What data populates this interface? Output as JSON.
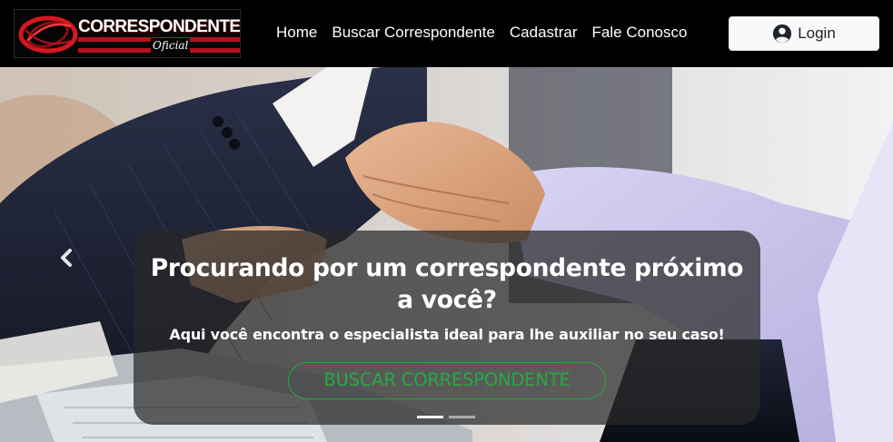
{
  "brand": {
    "logo_title": "CORRESPONDENTE",
    "logo_subtitle": "Oficial",
    "logo_icon": "red-ring-emblem"
  },
  "nav": {
    "items": [
      {
        "label": "Home"
      },
      {
        "label": "Buscar Correspondente"
      },
      {
        "label": "Cadastrar"
      },
      {
        "label": "Fale Conosco"
      }
    ],
    "login_label": "Login",
    "login_icon": "user-circle-icon"
  },
  "hero": {
    "background": "handshake-business-photo",
    "title": "Procurando por um correspondente próximo a você?",
    "subtitle": "Aqui você encontra o especialista ideal para lhe auxiliar no seu caso!",
    "cta_label": "BUSCAR CORRESPONDENTE",
    "prev_icon": "chevron-left-icon",
    "slides": 2,
    "active_slide": 1
  },
  "colors": {
    "navbar_bg": "#000000",
    "brand_red": "#b5121b",
    "cta_green": "#27a844",
    "caption_bg": "rgba(40,40,40,0.72)"
  }
}
